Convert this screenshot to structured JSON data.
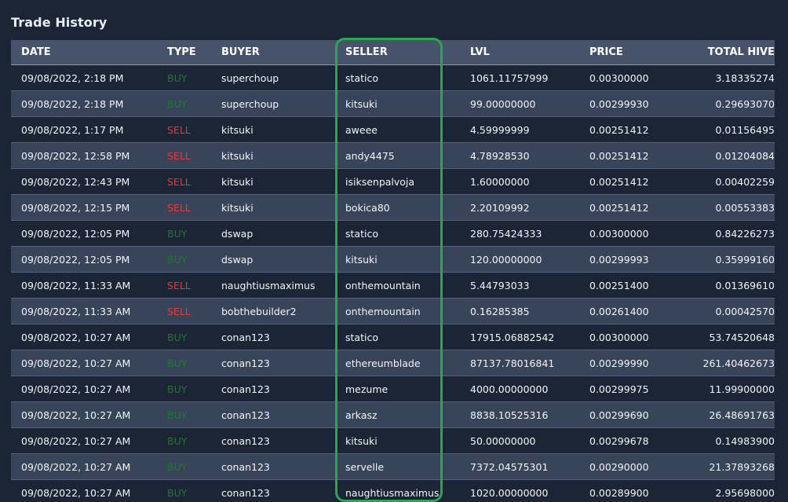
{
  "title": "Trade History",
  "columns": {
    "date": "DATE",
    "type": "TYPE",
    "buyer": "BUYER",
    "seller": "SELLER",
    "lvl": "LVL",
    "price": "PRICE",
    "total": "TOTAL HIVE"
  },
  "colors": {
    "buy": "#1d7a2a",
    "sell": "#e23b3b",
    "highlight": "#27a84c"
  },
  "rows": [
    {
      "date": "09/08/2022, 2:18 PM",
      "type": "BUY",
      "buyer": "superchoup",
      "seller": "statico",
      "lvl": "1061.11757999",
      "price": "0.00300000",
      "total": "3.18335274"
    },
    {
      "date": "09/08/2022, 2:18 PM",
      "type": "BUY",
      "buyer": "superchoup",
      "seller": "kitsuki",
      "lvl": "99.00000000",
      "price": "0.00299930",
      "total": "0.29693070"
    },
    {
      "date": "09/08/2022, 1:17 PM",
      "type": "SELL",
      "buyer": "kitsuki",
      "seller": "aweee",
      "lvl": "4.59999999",
      "price": "0.00251412",
      "total": "0.01156495"
    },
    {
      "date": "09/08/2022, 12:58 PM",
      "type": "SELL",
      "buyer": "kitsuki",
      "seller": "andy4475",
      "lvl": "4.78928530",
      "price": "0.00251412",
      "total": "0.01204084"
    },
    {
      "date": "09/08/2022, 12:43 PM",
      "type": "SELL",
      "buyer": "kitsuki",
      "seller": "isiksenpalvoja",
      "lvl": "1.60000000",
      "price": "0.00251412",
      "total": "0.00402259"
    },
    {
      "date": "09/08/2022, 12:15 PM",
      "type": "SELL",
      "buyer": "kitsuki",
      "seller": "bokica80",
      "lvl": "2.20109992",
      "price": "0.00251412",
      "total": "0.00553383"
    },
    {
      "date": "09/08/2022, 12:05 PM",
      "type": "BUY",
      "buyer": "dswap",
      "seller": "statico",
      "lvl": "280.75424333",
      "price": "0.00300000",
      "total": "0.84226273"
    },
    {
      "date": "09/08/2022, 12:05 PM",
      "type": "BUY",
      "buyer": "dswap",
      "seller": "kitsuki",
      "lvl": "120.00000000",
      "price": "0.00299993",
      "total": "0.35999160"
    },
    {
      "date": "09/08/2022, 11:33 AM",
      "type": "SELL",
      "buyer": "naughtiusmaximus",
      "seller": "onthemountain",
      "lvl": "5.44793033",
      "price": "0.00251400",
      "total": "0.01369610"
    },
    {
      "date": "09/08/2022, 11:33 AM",
      "type": "SELL",
      "buyer": "bobthebuilder2",
      "seller": "onthemountain",
      "lvl": "0.16285385",
      "price": "0.00261400",
      "total": "0.00042570"
    },
    {
      "date": "09/08/2022, 10:27 AM",
      "type": "BUY",
      "buyer": "conan123",
      "seller": "statico",
      "lvl": "17915.06882542",
      "price": "0.00300000",
      "total": "53.74520648"
    },
    {
      "date": "09/08/2022, 10:27 AM",
      "type": "BUY",
      "buyer": "conan123",
      "seller": "ethereumblade",
      "lvl": "87137.78016841",
      "price": "0.00299990",
      "total": "261.40462673"
    },
    {
      "date": "09/08/2022, 10:27 AM",
      "type": "BUY",
      "buyer": "conan123",
      "seller": "mezume",
      "lvl": "4000.00000000",
      "price": "0.00299975",
      "total": "11.99900000"
    },
    {
      "date": "09/08/2022, 10:27 AM",
      "type": "BUY",
      "buyer": "conan123",
      "seller": "arkasz",
      "lvl": "8838.10525316",
      "price": "0.00299690",
      "total": "26.48691763"
    },
    {
      "date": "09/08/2022, 10:27 AM",
      "type": "BUY",
      "buyer": "conan123",
      "seller": "kitsuki",
      "lvl": "50.00000000",
      "price": "0.00299678",
      "total": "0.14983900"
    },
    {
      "date": "09/08/2022, 10:27 AM",
      "type": "BUY",
      "buyer": "conan123",
      "seller": "servelle",
      "lvl": "7372.04575301",
      "price": "0.00290000",
      "total": "21.37893268"
    },
    {
      "date": "09/08/2022, 10:27 AM",
      "type": "BUY",
      "buyer": "conan123",
      "seller": "naughtiusmaximus",
      "lvl": "1020.00000000",
      "price": "0.00289900",
      "total": "2.95698000"
    }
  ]
}
